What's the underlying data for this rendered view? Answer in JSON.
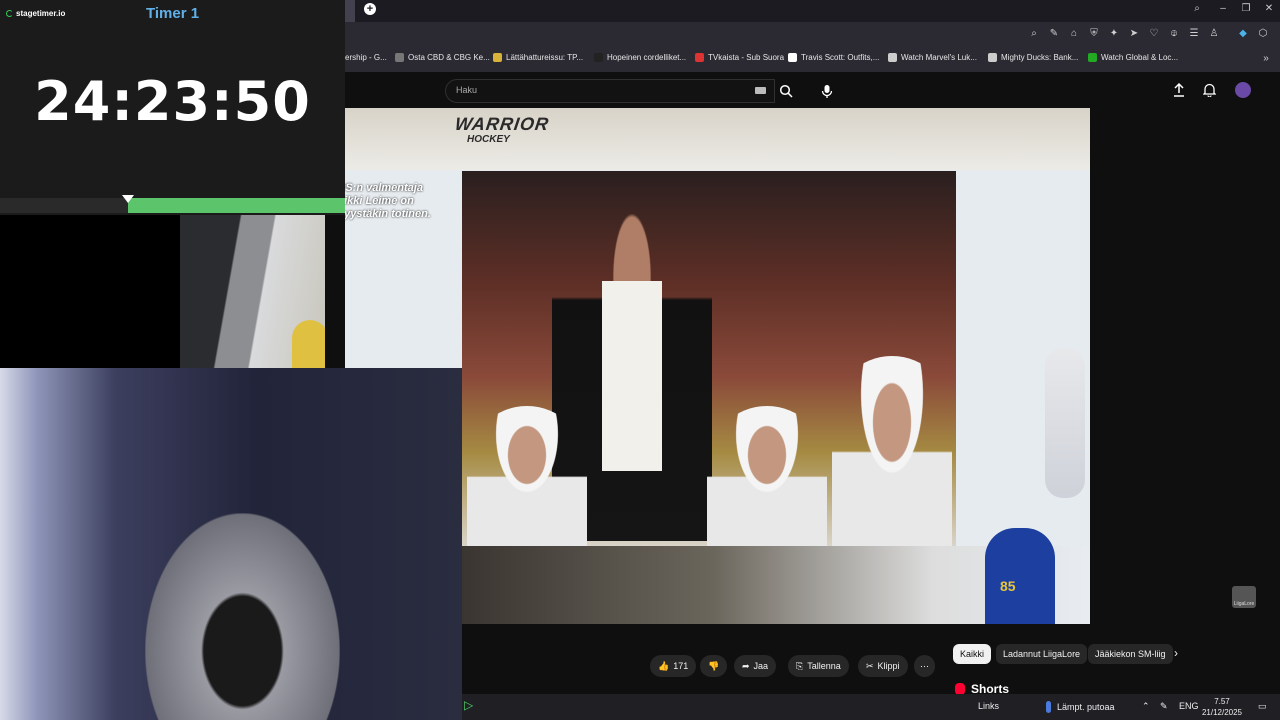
{
  "timer": {
    "brand": "stagetimer.io",
    "title": "Timer 1",
    "value": "24:23:50",
    "progress_elapsed_fraction": 0.37,
    "progress_color": "#5cc46b"
  },
  "bookmarks": [
    {
      "label": "ership - G...",
      "icon": "page-icon"
    },
    {
      "label": "Osta CBD & CBG Ke...",
      "icon": "globe-icon"
    },
    {
      "label": "Lättähattureissu: TP...",
      "icon": "page-icon"
    },
    {
      "label": "Hopeinen cordelliket...",
      "icon": "page-icon"
    },
    {
      "label": "TVkaista - Sub Suora",
      "icon": "tv-icon"
    },
    {
      "label": "Travis Scott: Outfits,...",
      "icon": "page-icon"
    },
    {
      "label": "Watch Marvel's Luk...",
      "icon": "page-icon"
    },
    {
      "label": "Mighty Ducks: Bank...",
      "icon": "page-icon"
    },
    {
      "label": "Watch Global & Loc...",
      "icon": "page-icon"
    }
  ],
  "youtube": {
    "search_placeholder": "Haku",
    "video_caption": "PS:n valmentaja eikki Leime on syystäkin totinen.",
    "board_text_1": "WARRIOR",
    "board_text_2": "HOCKEY",
    "jersey_number": "85",
    "channel_watermark": "LiigaLore",
    "actions": {
      "like_count": "171",
      "share_label": "Jaa",
      "save_label": "Tallenna",
      "clip_label": "Klippi"
    },
    "chips": [
      "Kaikki",
      "Ladannut LiigaLore",
      "Jääkiekon SM-liig"
    ],
    "shorts_label": "Shorts"
  },
  "taskbar": {
    "links_label": "Links",
    "weather_label": "Lämpt. putoaa",
    "language": "ENG",
    "time": "7.57",
    "date": "21/12/2025"
  }
}
